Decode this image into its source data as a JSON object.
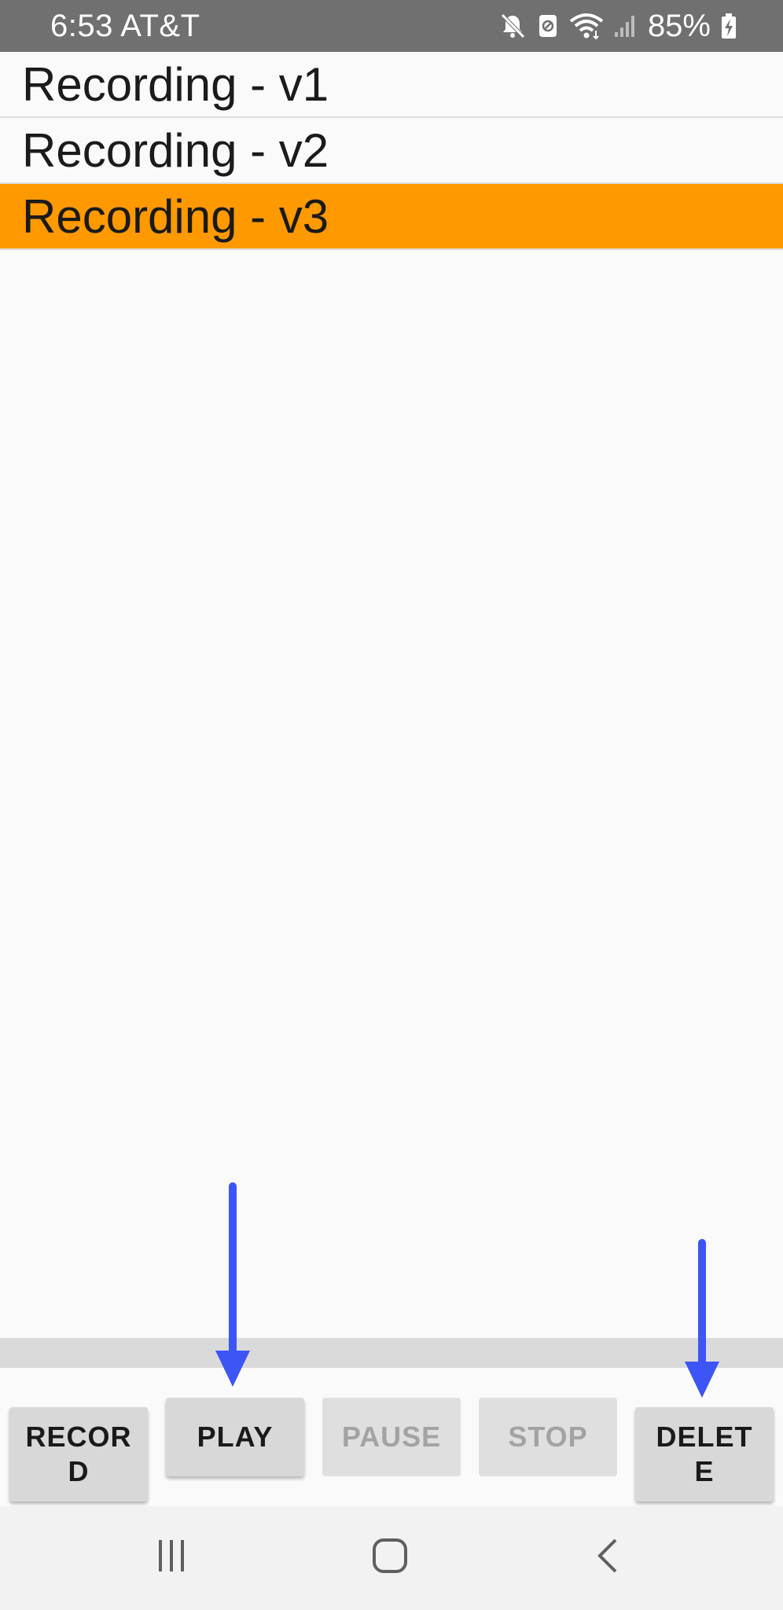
{
  "status_bar": {
    "time_carrier": "6:53 AT&T",
    "battery_percent": "85%",
    "icons": [
      "mute-icon",
      "data-saver-icon",
      "wifi-icon",
      "signal-icon",
      "battery-charging-icon"
    ]
  },
  "recordings": [
    {
      "label": "Recording - v1",
      "selected": false
    },
    {
      "label": "Recording - v2",
      "selected": false
    },
    {
      "label": "Recording - v3",
      "selected": true
    }
  ],
  "controls": {
    "record": {
      "label": "RECORD",
      "enabled": true
    },
    "play": {
      "label": "PLAY",
      "enabled": true
    },
    "pause": {
      "label": "PAUSE",
      "enabled": false
    },
    "stop": {
      "label": "STOP",
      "enabled": false
    },
    "delete": {
      "label": "DELETE",
      "enabled": true
    }
  },
  "annotations": {
    "arrow_color": "#3d55f5",
    "arrows_point_to": [
      "play",
      "delete"
    ]
  },
  "nav_bar": {
    "icons": [
      "recents-icon",
      "home-icon",
      "back-icon"
    ]
  },
  "colors": {
    "selected_row": "#ff9900",
    "status_bar": "#707070"
  }
}
